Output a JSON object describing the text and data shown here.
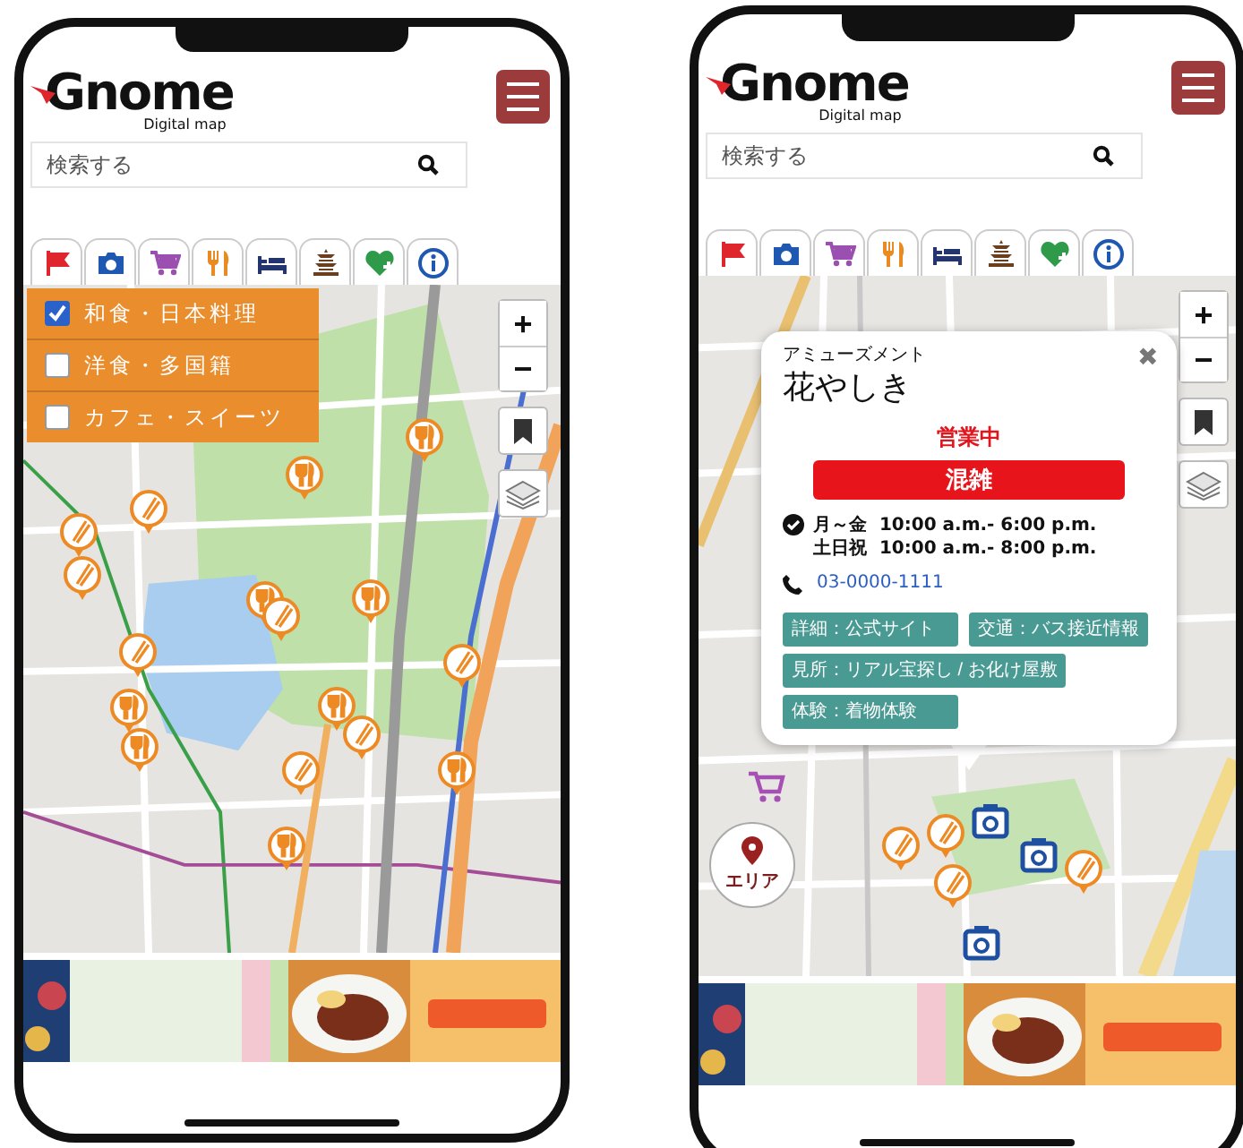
{
  "phones": [
    {
      "logo": {
        "wordmark": "Gnome",
        "tagline": "Digital map"
      },
      "search": {
        "placeholder": "検索する"
      },
      "category_tabs": [
        {
          "kind": "flag"
        },
        {
          "kind": "camera"
        },
        {
          "kind": "cart"
        },
        {
          "kind": "food"
        },
        {
          "kind": "bed"
        },
        {
          "kind": "pagoda"
        },
        {
          "kind": "heart"
        },
        {
          "kind": "info"
        }
      ],
      "map": {
        "kind": "picture",
        "zoom_controls": [
          "+",
          "−"
        ],
        "filter_menu": [
          {
            "label": "和食・日本料理",
            "checked": true
          },
          {
            "label": "洋食・多国籍",
            "checked": false
          },
          {
            "label": "カフェ・スイーツ",
            "checked": false
          }
        ]
      }
    },
    {
      "logo": {
        "wordmark": "Gnome",
        "tagline": "Digital map"
      },
      "search": {
        "placeholder": "検索する"
      },
      "category_tabs": [
        {
          "kind": "flag"
        },
        {
          "kind": "camera"
        },
        {
          "kind": "cart"
        },
        {
          "kind": "food"
        },
        {
          "kind": "bed"
        },
        {
          "kind": "pagoda"
        },
        {
          "kind": "heart"
        },
        {
          "kind": "info"
        }
      ],
      "map": {
        "kind": "picture",
        "zoom_controls": [
          "+",
          "−"
        ],
        "popup": {
          "category": "アミューズメント",
          "title": "花やしき",
          "close": "✖",
          "status": "営業中",
          "crowd": "混雑",
          "hours": [
            {
              "days": "月～金",
              "time": "10:00 a.m.- 6:00 p.m."
            },
            {
              "days": "土日祝",
              "time": "10:00 a.m.- 8:00 p.m."
            }
          ],
          "phone": "03-0000-1111",
          "links": [
            "詳細：公式サイト",
            "交通：バス接近情報",
            "見所：リアル宝探し / お化け屋敷",
            "体験：着物体験"
          ]
        },
        "area_button": {
          "label": "エリア"
        }
      }
    }
  ]
}
